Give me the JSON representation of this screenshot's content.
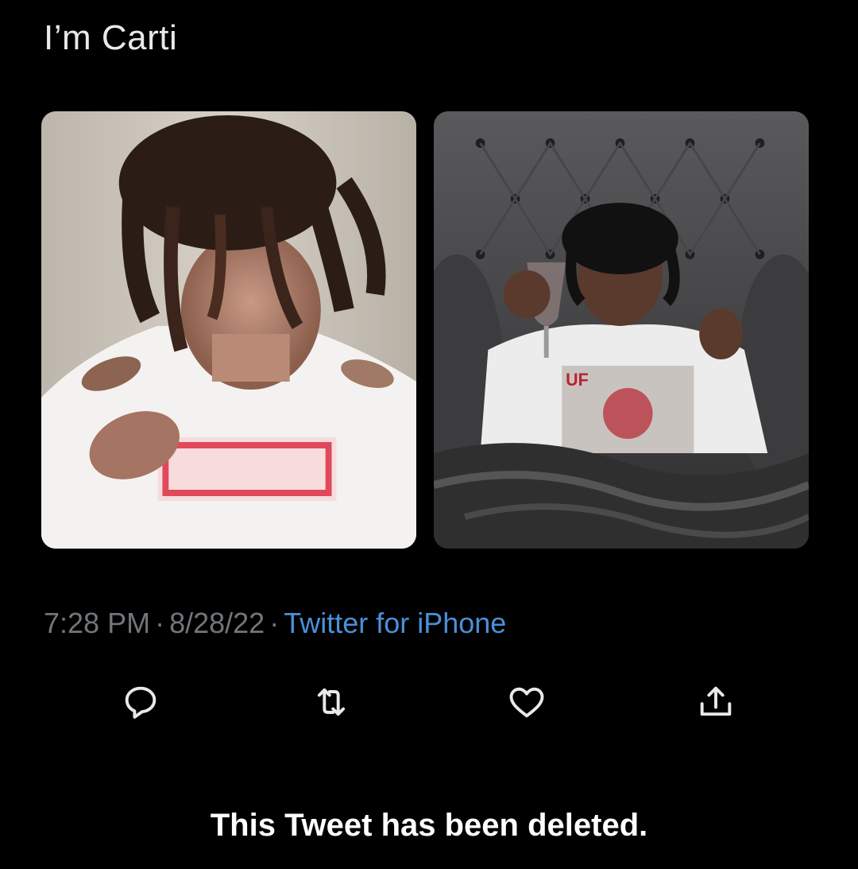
{
  "tweet": {
    "text": "I’m Carti",
    "media": [
      {
        "description_icon": "photo-left"
      },
      {
        "description_icon": "photo-right"
      }
    ],
    "meta": {
      "time": "7:28 PM",
      "separator": "·",
      "date": "8/28/22",
      "source": "Twitter for iPhone"
    }
  },
  "actions": [
    {
      "icon": "reply-icon"
    },
    {
      "icon": "retweet-icon"
    },
    {
      "icon": "like-icon"
    },
    {
      "icon": "share-icon"
    }
  ],
  "notice": "This Tweet has been deleted.",
  "colors": {
    "background": "#000000",
    "text": "#e7e9ea",
    "muted": "#71767b",
    "link": "#4a90d9",
    "icon": "#e7e9ea"
  }
}
